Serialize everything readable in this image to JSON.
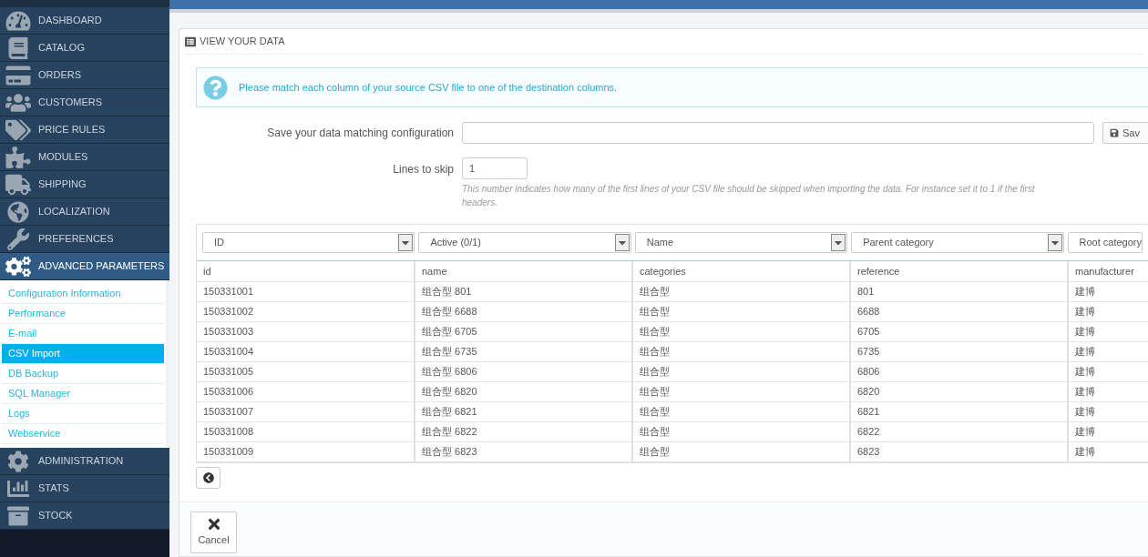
{
  "sidebar": {
    "items": [
      {
        "label": "DASHBOARD",
        "selected": false
      },
      {
        "label": "CATALOG",
        "selected": false
      },
      {
        "label": "ORDERS",
        "selected": false
      },
      {
        "label": "CUSTOMERS",
        "selected": false
      },
      {
        "label": "PRICE RULES",
        "selected": false
      },
      {
        "label": "MODULES",
        "selected": false
      },
      {
        "label": "SHIPPING",
        "selected": false
      },
      {
        "label": "LOCALIZATION",
        "selected": false
      },
      {
        "label": "PREFERENCES",
        "selected": false
      },
      {
        "label": "ADVANCED PARAMETERS",
        "selected": true,
        "children": [
          {
            "label": "Configuration Information",
            "selected": false
          },
          {
            "label": "Performance",
            "selected": false
          },
          {
            "label": "E-mail",
            "selected": false
          },
          {
            "label": "CSV Import",
            "selected": true
          },
          {
            "label": "DB Backup",
            "selected": false
          },
          {
            "label": "SQL Manager",
            "selected": false
          },
          {
            "label": "Logs",
            "selected": false
          },
          {
            "label": "Webservice",
            "selected": false
          }
        ]
      },
      {
        "label": "ADMINISTRATION",
        "selected": false
      },
      {
        "label": "STATS",
        "selected": false
      },
      {
        "label": "STOCK",
        "selected": false
      }
    ]
  },
  "panel": {
    "title": "VIEW YOUR DATA",
    "info": "Please match each column of your source CSV file to one of the destination columns.",
    "save_config": {
      "label": "Save your data matching configuration",
      "button": "Sav"
    },
    "lines_to_skip": {
      "label": "Lines to skip",
      "value": "1",
      "hint": [
        "This number indicates how many of the first lines of your CSV file should be skipped when importing the data. For instance set it to 1 if the first",
        "headers."
      ]
    },
    "column_selects": [
      "ID",
      "Active (0/1)",
      "Name",
      "Parent category",
      "Root category"
    ],
    "table": {
      "columns": [
        "id",
        "name",
        "categories",
        "reference",
        "manufacturer"
      ],
      "rows": [
        [
          "150331001",
          "组合型 801",
          "组合型",
          "801",
          "建博"
        ],
        [
          "150331002",
          "组合型 6688",
          "组合型",
          "6688",
          "建博"
        ],
        [
          "150331003",
          "组合型 6705",
          "组合型",
          "6705",
          "建博"
        ],
        [
          "150331004",
          "组合型 6735",
          "组合型",
          "6735",
          "建博"
        ],
        [
          "150331005",
          "组合型 6806",
          "组合型",
          "6806",
          "建博"
        ],
        [
          "150331006",
          "组合型 6820",
          "组合型",
          "6820",
          "建博"
        ],
        [
          "150331007",
          "组合型 6821",
          "组合型",
          "6821",
          "建博"
        ],
        [
          "150331008",
          "组合型 6822",
          "组合型",
          "6822",
          "建博"
        ],
        [
          "150331009",
          "组合型 6823",
          "组合型",
          "6823",
          "建博"
        ]
      ]
    },
    "cancel": "Cancel"
  }
}
